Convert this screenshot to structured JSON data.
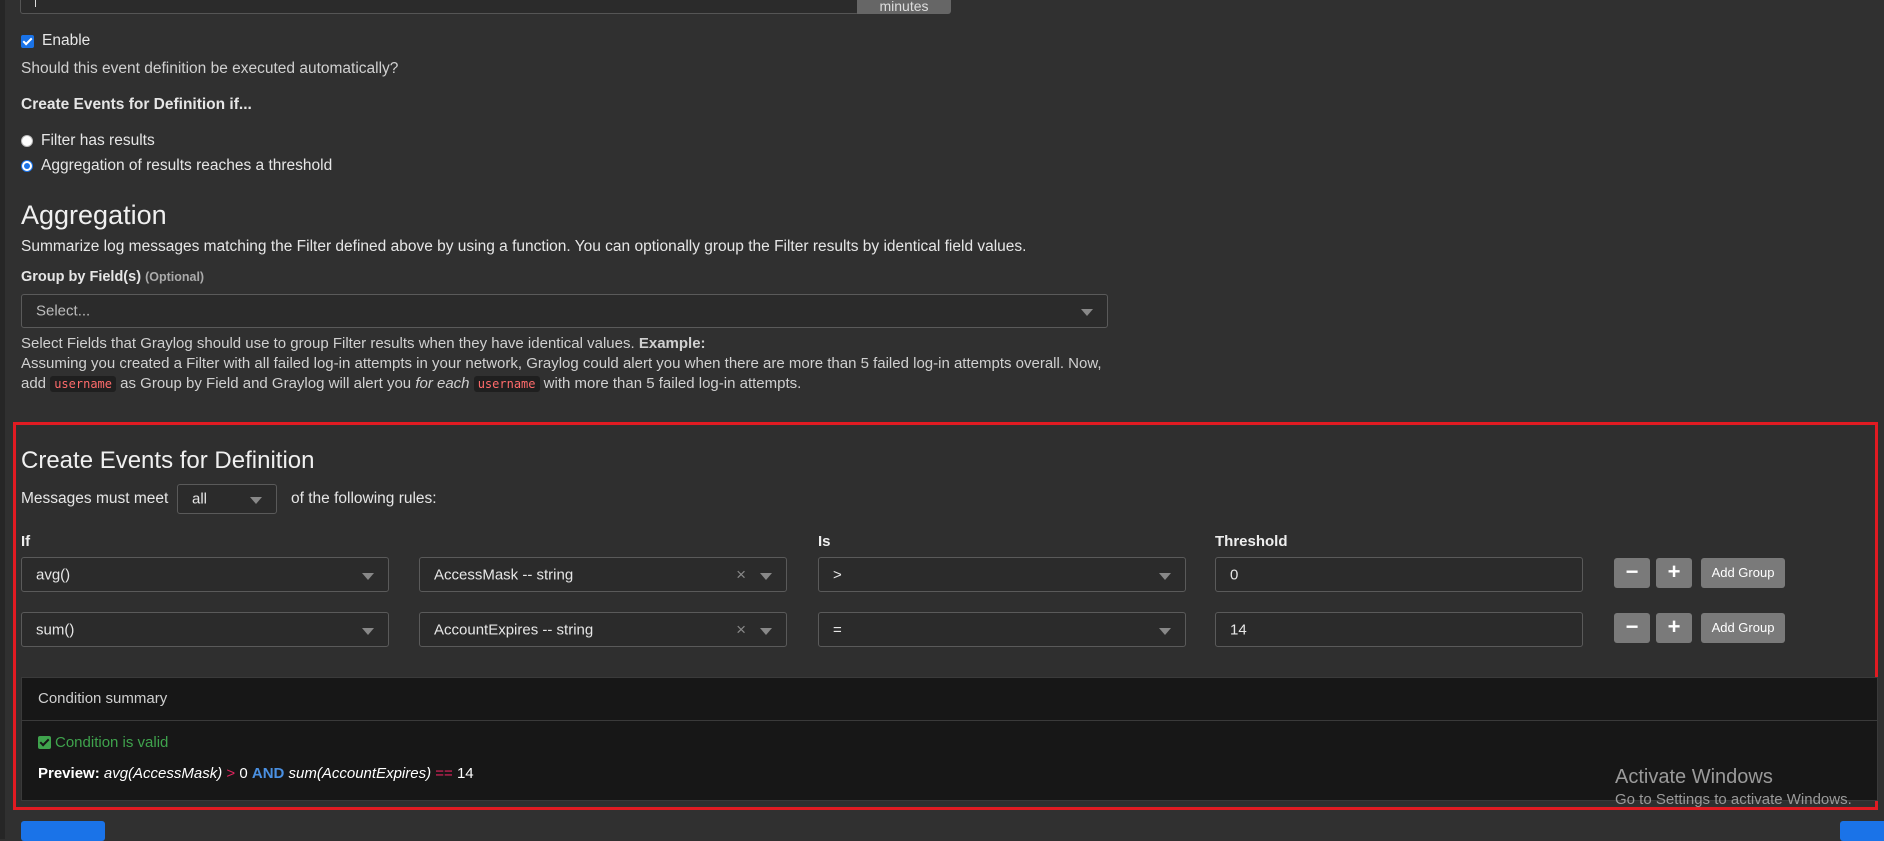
{
  "top": {
    "unit_button": "minutes"
  },
  "enable": {
    "label": "Enable",
    "help": "Should this event definition be executed automatically?"
  },
  "create_events_if": {
    "heading": "Create Events for Definition if...",
    "options": [
      {
        "label": "Filter has results",
        "selected": false
      },
      {
        "label": "Aggregation of results reaches a threshold",
        "selected": true
      }
    ]
  },
  "aggregation": {
    "title": "Aggregation",
    "description": "Summarize log messages matching the Filter defined above by using a function. You can optionally group the Filter results by identical field values.",
    "group_by_label": "Group by Field(s)",
    "group_by_optional": "(Optional)",
    "group_by_placeholder": "Select...",
    "help_line1": "Select Fields that Graylog should use to group Filter results when they have identical values.",
    "help_example": "Example:",
    "help_line2": "Assuming you created a Filter with all failed log-in attempts in your network, Graylog could alert you when there are more than 5 failed log-in attempts overall. Now,",
    "help_add": "add",
    "help_code1": "username",
    "help_mid": "as Group by Field and Graylog will alert you",
    "help_for_each": "for each",
    "help_code2": "username",
    "help_end": "with more than 5 failed log-in attempts."
  },
  "definition": {
    "title": "Create Events for Definition",
    "must_meet_prefix": "Messages must meet",
    "must_meet_value": "all",
    "must_meet_suffix": "of the following rules:",
    "headers": {
      "if": "If",
      "is": "Is",
      "threshold": "Threshold"
    },
    "rules": [
      {
        "function": "avg()",
        "field": "AccessMask -- string",
        "operator": ">",
        "threshold": "0"
      },
      {
        "function": "sum()",
        "field": "AccountExpires -- string",
        "operator": "=",
        "threshold": "14"
      }
    ],
    "minus_label": "−",
    "plus_label": "+",
    "add_group_label": "Add Group"
  },
  "summary": {
    "title": "Condition summary",
    "valid_text": "Condition is valid",
    "preview_label": "Preview:",
    "preview_left": "avg(AccessMask)",
    "preview_op1": ">",
    "preview_val1": "0",
    "preview_and": "AND",
    "preview_right": "sum(AccountExpires)",
    "preview_op2": "==",
    "preview_val2": "14"
  },
  "watermark": {
    "line1": "Activate Windows",
    "line2": "Go to Settings to activate Windows."
  },
  "colors": {
    "highlight_border": "#e11b22",
    "accent": "#1a73e8",
    "valid": "#3fa34d",
    "operator": "#e0245e",
    "and": "#4a90e2"
  }
}
